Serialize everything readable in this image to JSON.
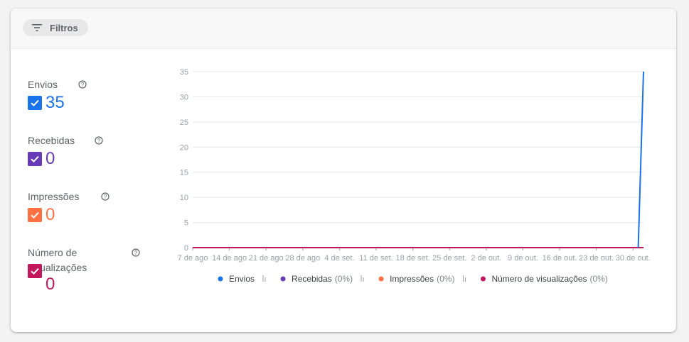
{
  "header": {
    "filter_label": "Filtros"
  },
  "metrics": [
    {
      "label": "Envios",
      "value": "35",
      "color": "#1a73e8",
      "checked": true
    },
    {
      "label": "Recebidas",
      "value": "0",
      "color": "#673ab7",
      "checked": true
    },
    {
      "label": "Impressões",
      "value": "0",
      "color": "#ff7043",
      "checked": true
    },
    {
      "label": "Número de visualizações",
      "label_lines": [
        "Número de",
        "visualizações"
      ],
      "value": "0",
      "color": "#c2185b",
      "checked": true
    }
  ],
  "chart_data": {
    "type": "line",
    "categories": [
      "7 de ago",
      "14 de ago",
      "21 de ago",
      "28 de ago",
      "4 de set.",
      "11 de set.",
      "18 de set.",
      "25 de set.",
      "2 de out.",
      "9 de out.",
      "16 de out.",
      "23 de out.",
      "30 de out."
    ],
    "x_start": "2023-08-07",
    "x_end": "2023-11-01",
    "ylim": [
      0,
      35
    ],
    "yticks": [
      0,
      5,
      10,
      15,
      20,
      25,
      30,
      35
    ],
    "grid": true,
    "legend_placement": "bottom",
    "series": [
      {
        "name": "Envios",
        "pct": "",
        "color": "#1a73e8",
        "values": [
          [
            "2023-10-31",
            0
          ],
          [
            "2023-11-01",
            35
          ]
        ]
      },
      {
        "name": "Recebidas",
        "pct": "(0%)",
        "color": "#673ab7",
        "values": [
          [
            "2023-08-07",
            0
          ],
          [
            "2023-11-01",
            0
          ]
        ]
      },
      {
        "name": "Impressões",
        "pct": "(0%)",
        "color": "#ff7043",
        "values": [
          [
            "2023-08-07",
            0
          ],
          [
            "2023-11-01",
            0
          ]
        ]
      },
      {
        "name": "Número de visualizações",
        "pct": "(0%)",
        "color": "#c2185b",
        "values": [
          [
            "2023-08-07",
            0
          ],
          [
            "2023-11-01",
            0
          ]
        ]
      }
    ]
  }
}
